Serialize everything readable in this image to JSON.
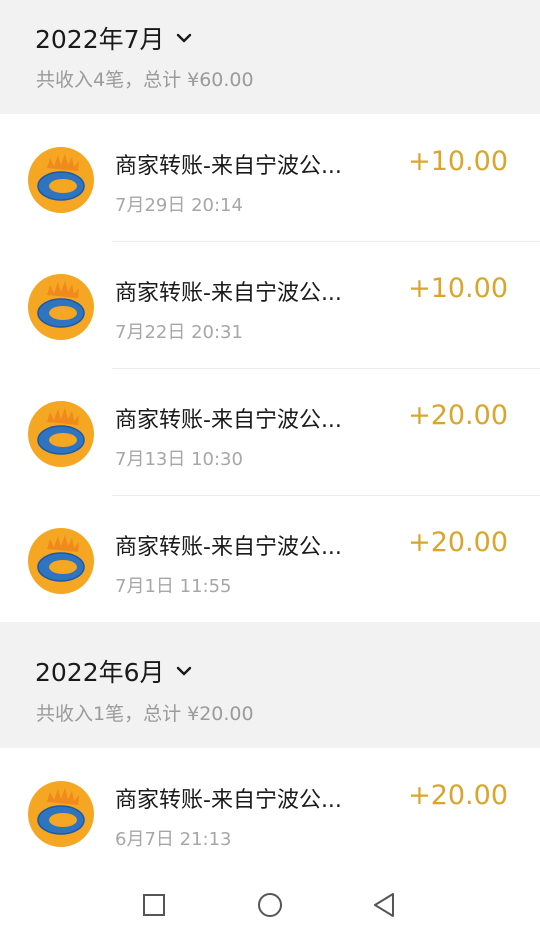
{
  "sections": [
    {
      "month": "2022年7月",
      "summary": "共收入4笔，总计 ¥60.00",
      "transactions": [
        {
          "title": "商家转账-来自宁波公...",
          "time": "7月29日 20:14",
          "amount": "+10.00"
        },
        {
          "title": "商家转账-来自宁波公...",
          "time": "7月22日 20:31",
          "amount": "+10.00"
        },
        {
          "title": "商家转账-来自宁波公...",
          "time": "7月13日 10:30",
          "amount": "+20.00"
        },
        {
          "title": "商家转账-来自宁波公...",
          "time": "7月1日 11:55",
          "amount": "+20.00"
        }
      ]
    },
    {
      "month": "2022年6月",
      "summary": "共收入1笔，总计 ¥20.00",
      "transactions": [
        {
          "title": "商家转账-来自宁波公...",
          "time": "6月7日 21:13",
          "amount": "+20.00"
        }
      ]
    }
  ],
  "colors": {
    "amount": "#d9a52b",
    "header_bg": "#f2f2f2",
    "avatar_orange": "#f5a623",
    "avatar_blue": "#2f74c0"
  },
  "icons": {
    "chevron": "chevron-down-icon",
    "avatar": "merchant-logo-icon",
    "nav": [
      "recents-square-icon",
      "home-circle-icon",
      "back-triangle-icon"
    ]
  }
}
